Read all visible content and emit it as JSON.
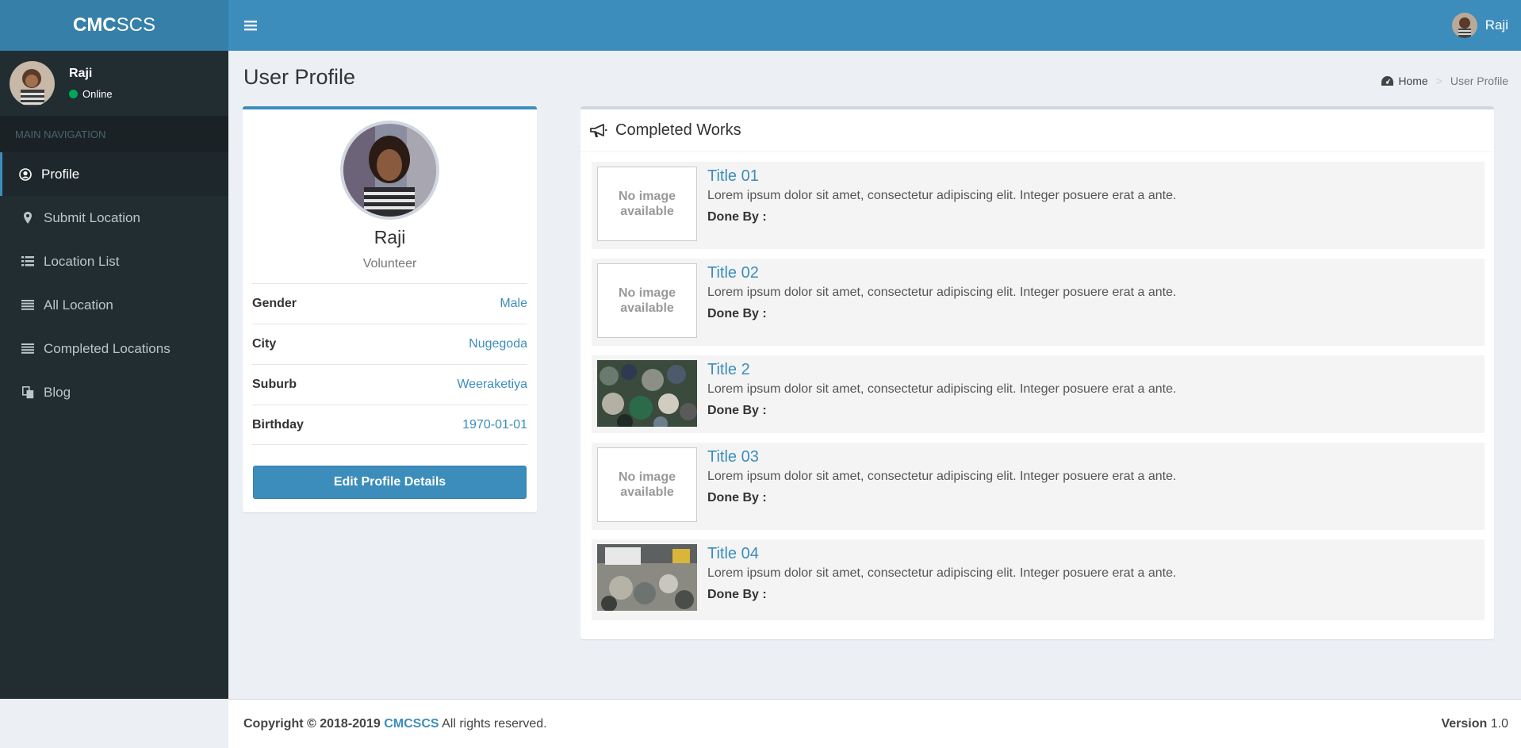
{
  "app": {
    "logo_bold": "CMC",
    "logo_light": "SCS",
    "user_name": "Raji"
  },
  "sidebar": {
    "user": {
      "name": "Raji",
      "status": "Online"
    },
    "nav_header": "MAIN NAVIGATION",
    "items": [
      {
        "label": "Profile",
        "icon": "user-circle-icon",
        "active": true
      },
      {
        "label": "Submit Location",
        "icon": "map-marker-icon"
      },
      {
        "label": "Location List",
        "icon": "list-icon"
      },
      {
        "label": "All Location",
        "icon": "bars-icon"
      },
      {
        "label": "Completed Locations",
        "icon": "bars-icon"
      },
      {
        "label": "Blog",
        "icon": "copy-icon"
      }
    ]
  },
  "page": {
    "title": "User Profile",
    "breadcrumb": {
      "home": "Home",
      "current": "User Profile"
    }
  },
  "profile": {
    "name": "Raji",
    "role": "Volunteer",
    "fields": [
      {
        "label": "Gender",
        "value": "Male"
      },
      {
        "label": "City",
        "value": "Nugegoda"
      },
      {
        "label": "Suburb",
        "value": "Weeraketiya"
      },
      {
        "label": "Birthday",
        "value": "1970-01-01"
      }
    ],
    "edit_button": "Edit Profile Details"
  },
  "works": {
    "heading": "Completed Works",
    "no_image_text": "No image available",
    "done_by_label": "Done By :",
    "items": [
      {
        "title": "Title 01",
        "description": "Lorem ipsum dolor sit amet, consectetur adipiscing elit. Integer posuere erat a ante.",
        "image": "none"
      },
      {
        "title": "Title 02",
        "description": "Lorem ipsum dolor sit amet, consectetur adipiscing elit. Integer posuere erat a ante.",
        "image": "none"
      },
      {
        "title": "Title 2",
        "description": "Lorem ipsum dolor sit amet, consectetur adipiscing elit. Integer posuere erat a ante.",
        "image": "photo"
      },
      {
        "title": "Title 03",
        "description": "Lorem ipsum dolor sit amet, consectetur adipiscing elit. Integer posuere erat a ante.",
        "image": "none"
      },
      {
        "title": "Title 04",
        "description": "Lorem ipsum dolor sit amet, consectetur adipiscing elit. Integer posuere erat a ante.",
        "image": "photo"
      }
    ]
  },
  "footer": {
    "copyright": "Copyright © 2018-2019",
    "brand": "CMCSCS",
    "rights": "All rights reserved.",
    "version_label": "Version",
    "version_value": "1.0"
  },
  "colors": {
    "primary": "#3c8dbc",
    "logo_bg": "#367fa9",
    "sidebar_bg": "#222d32",
    "online": "#00a65a"
  }
}
